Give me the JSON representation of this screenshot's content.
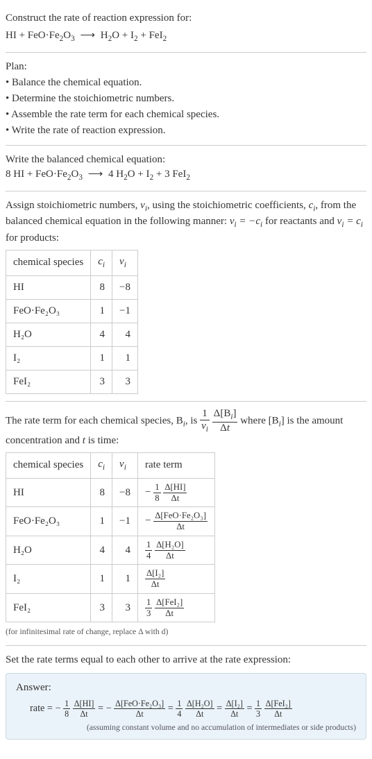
{
  "title": "Construct the rate of reaction expression for:",
  "unbalanced_left": "HI + FeO·Fe",
  "unbalanced_left_sub1": "2",
  "unbalanced_left_mid": "O",
  "unbalanced_left_sub2": "3",
  "arrow": "⟶",
  "unbalanced_right_a": "H",
  "unbalanced_right_a_s": "2",
  "unbalanced_right_b": "O + I",
  "unbalanced_right_b_s": "2",
  "unbalanced_right_c": " + FeI",
  "unbalanced_right_c_s": "2",
  "plan_title": "Plan:",
  "plan_items": [
    "• Balance the chemical equation.",
    "• Determine the stoichiometric numbers.",
    "• Assemble the rate term for each chemical species.",
    "• Write the rate of reaction expression."
  ],
  "balanced_title": "Write the balanced chemical equation:",
  "balanced_eq_left": "8 HI + FeO·Fe",
  "balanced_eq_left_s1": "2",
  "balanced_eq_left_mid": "O",
  "balanced_eq_left_s2": "3",
  "balanced_eq_right_a": "4 H",
  "balanced_eq_right_a_s": "2",
  "balanced_eq_right_b": "O + I",
  "balanced_eq_right_b_s": "2",
  "balanced_eq_right_c": " + 3 FeI",
  "balanced_eq_right_c_s": "2",
  "stoich_para_1": "Assign stoichiometric numbers, ",
  "stoich_nu": "ν",
  "stoich_i": "i",
  "stoich_para_2": ", using the stoichiometric coefficients, ",
  "stoich_c": "c",
  "stoich_para_3": ", from the balanced chemical equation in the following manner: ",
  "stoich_rel_react": " = −",
  "stoich_para_4": " for reactants and ",
  "stoich_rel_prod": " = ",
  "stoich_para_5": " for products:",
  "tbl1": {
    "h1": "chemical species",
    "h2": "c",
    "h3": "ν",
    "rows": [
      {
        "sp": "HI",
        "c": "8",
        "nu": "−8"
      },
      {
        "sp": "FeO·Fe₂O₃",
        "c": "1",
        "nu": "−1"
      },
      {
        "sp": "H₂O",
        "c": "4",
        "nu": "4"
      },
      {
        "sp": "I₂",
        "c": "1",
        "nu": "1"
      },
      {
        "sp": "FeI₂",
        "c": "3",
        "nu": "3"
      }
    ]
  },
  "rateterm_para_1": "The rate term for each chemical species, B",
  "rateterm_para_2": ", is ",
  "rateterm_para_3": " where [B",
  "rateterm_para_4": "] is the amount concentration and ",
  "rateterm_t": "t",
  "rateterm_para_5": " is time:",
  "tbl2": {
    "h1": "chemical species",
    "h2": "c",
    "h3": "ν",
    "h4": "rate term",
    "rows": [
      {
        "sp": "HI",
        "c": "8",
        "nu": "−8",
        "pre": "−",
        "coef_num": "1",
        "coef_den": "8",
        "dnum": "Δ[HI]",
        "dden": "Δt"
      },
      {
        "sp": "FeO·Fe₂O₃",
        "c": "1",
        "nu": "−1",
        "pre": "−",
        "coef_num": "",
        "coef_den": "",
        "dnum": "Δ[FeO·Fe₂O₃]",
        "dden": "Δt"
      },
      {
        "sp": "H₂O",
        "c": "4",
        "nu": "4",
        "pre": "",
        "coef_num": "1",
        "coef_den": "4",
        "dnum": "Δ[H₂O]",
        "dden": "Δt"
      },
      {
        "sp": "I₂",
        "c": "1",
        "nu": "1",
        "pre": "",
        "coef_num": "",
        "coef_den": "",
        "dnum": "Δ[I₂]",
        "dden": "Δt"
      },
      {
        "sp": "FeI₂",
        "c": "3",
        "nu": "3",
        "pre": "",
        "coef_num": "1",
        "coef_den": "3",
        "dnum": "Δ[FeI₂]",
        "dden": "Δt"
      }
    ]
  },
  "infinitesimal_note": "(for infinitesimal rate of change, replace Δ with d)",
  "set_equal": "Set the rate terms equal to each other to arrive at the rate expression:",
  "answer": {
    "title": "Answer:",
    "rate_label": "rate = ",
    "eq": " = ",
    "terms": [
      {
        "pre": "−",
        "coef_num": "1",
        "coef_den": "8",
        "dnum": "Δ[HI]",
        "dden": "Δt"
      },
      {
        "pre": "−",
        "coef_num": "",
        "coef_den": "",
        "dnum": "Δ[FeO·Fe₂O₃]",
        "dden": "Δt"
      },
      {
        "pre": "",
        "coef_num": "1",
        "coef_den": "4",
        "dnum": "Δ[H₂O]",
        "dden": "Δt"
      },
      {
        "pre": "",
        "coef_num": "",
        "coef_den": "",
        "dnum": "Δ[I₂]",
        "dden": "Δt"
      },
      {
        "pre": "",
        "coef_num": "1",
        "coef_den": "3",
        "dnum": "Δ[FeI₂]",
        "dden": "Δt"
      }
    ],
    "note": "(assuming constant volume and no accumulation of intermediates or side products)"
  }
}
